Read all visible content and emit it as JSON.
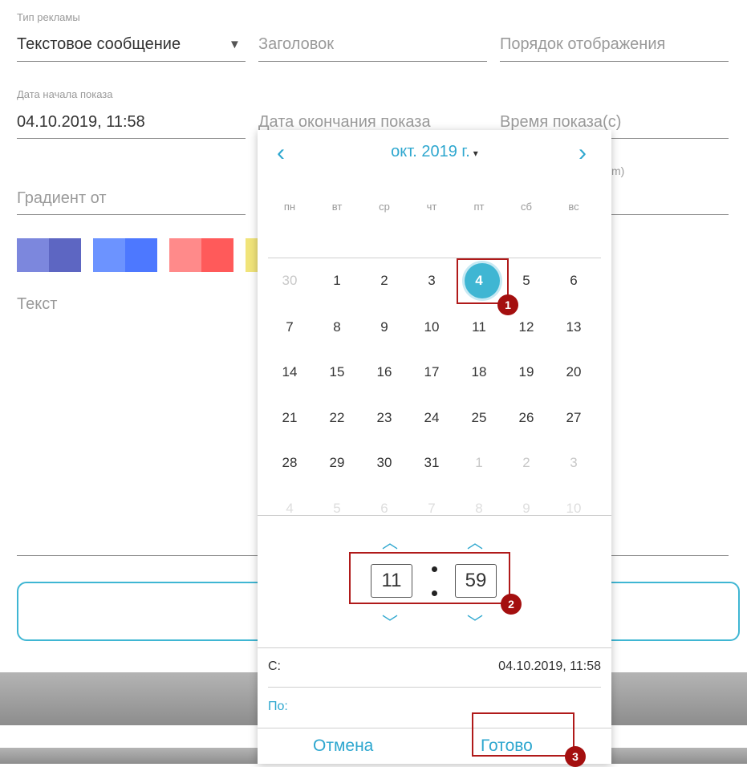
{
  "form": {
    "ad_type_label": "Тип рекламы",
    "ad_type_value": "Текстовое сообщение",
    "title_placeholder": "Заголовок",
    "display_order_placeholder": "Порядок отображения",
    "start_date_label": "Дата начала показа",
    "start_date_value": "04.10.2019, 11:58",
    "end_date_placeholder": "Дата окончания показа",
    "display_time_placeholder": "Время показа(с)",
    "partial_hidden_label": "m)",
    "gradient_from_placeholder": "Градиент от",
    "text_label": "Текст",
    "swatches": [
      {
        "left": "#7c87dd",
        "right": "#5d66c2"
      },
      {
        "left": "#6c93ff",
        "right": "#4d78ff"
      },
      {
        "left": "#ff8a8a",
        "right": "#ff5a5a"
      },
      {
        "left": "#f1e47a",
        "right": "#f1e47a"
      }
    ]
  },
  "calendar": {
    "prev_label": "‹",
    "next_label": "›",
    "month_label": "окт. 2019 г.",
    "month_caret": "▾",
    "weekdays": [
      "пн",
      "вт",
      "ср",
      "чт",
      "пт",
      "сб",
      "вс"
    ],
    "weeks": [
      [
        {
          "d": "30",
          "m": true
        },
        {
          "d": "1"
        },
        {
          "d": "2"
        },
        {
          "d": "3"
        },
        {
          "d": "4",
          "sel": true
        },
        {
          "d": "5"
        },
        {
          "d": "6"
        }
      ],
      [
        {
          "d": "7"
        },
        {
          "d": "8"
        },
        {
          "d": "9"
        },
        {
          "d": "10"
        },
        {
          "d": "11"
        },
        {
          "d": "12"
        },
        {
          "d": "13"
        }
      ],
      [
        {
          "d": "14"
        },
        {
          "d": "15"
        },
        {
          "d": "16"
        },
        {
          "d": "17"
        },
        {
          "d": "18"
        },
        {
          "d": "19"
        },
        {
          "d": "20"
        }
      ],
      [
        {
          "d": "21"
        },
        {
          "d": "22"
        },
        {
          "d": "23"
        },
        {
          "d": "24"
        },
        {
          "d": "25"
        },
        {
          "d": "26"
        },
        {
          "d": "27"
        }
      ],
      [
        {
          "d": "28"
        },
        {
          "d": "29"
        },
        {
          "d": "30"
        },
        {
          "d": "31"
        },
        {
          "d": "1",
          "m": true
        },
        {
          "d": "2",
          "m": true
        },
        {
          "d": "3",
          "m": true
        }
      ],
      [
        {
          "d": "4",
          "m": true
        },
        {
          "d": "5",
          "m": true
        },
        {
          "d": "6",
          "m": true
        },
        {
          "d": "7",
          "m": true
        },
        {
          "d": "8",
          "m": true
        },
        {
          "d": "9",
          "m": true
        },
        {
          "d": "10",
          "m": true
        }
      ]
    ],
    "hour": "11",
    "minute": "59",
    "up_chevron": "︿",
    "down_chevron": "﹀",
    "from_label": "С:",
    "from_value": "04.10.2019, 11:58",
    "to_label": "По:",
    "cancel_label": "Отмена",
    "done_label": "Готово"
  },
  "annotations": {
    "badge_1": "1",
    "badge_2": "2",
    "badge_3": "3"
  }
}
